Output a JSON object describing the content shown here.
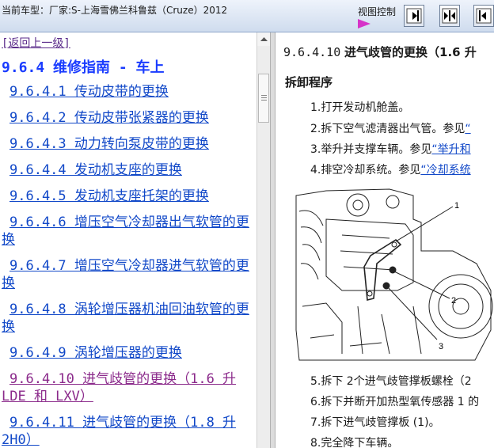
{
  "header": {
    "car_title": "当前车型：厂家:S-上海雪佛兰科鲁兹（Cruze）2012",
    "view_control_label": "视图控制"
  },
  "left": {
    "back_link": "[返回上一级]",
    "section_title": "9.6.4 维修指南 - 车上",
    "toc": [
      {
        "text": "9.6.4.1 传动皮带的更换"
      },
      {
        "text": "9.6.4.2 传动皮带张紧器的更换"
      },
      {
        "text": "9.6.4.3 动力转向泵皮带的更换"
      },
      {
        "text": "9.6.4.4 发动机支座的更换"
      },
      {
        "text": "9.6.4.5 发动机支座托架的更换"
      },
      {
        "text": "9.6.4.6 增压空气冷却器出气软管的更换"
      },
      {
        "text": "9.6.4.7 增压空气冷却器进气软管的更换"
      },
      {
        "text": "9.6.4.8 涡轮增压器机油回油软管的更换"
      },
      {
        "text": "9.6.4.9 涡轮增压器的更换"
      },
      {
        "text": "9.6.4.10 进气歧管的更换（1.6 升 LDE 和 LXV）"
      },
      {
        "text": "9.6.4.11 进气歧管的更换（1.8 升 2H0）"
      }
    ]
  },
  "right": {
    "title_num": "9.6.4.10",
    "title_text": "进气歧管的更换（1.6 升",
    "subhead": "拆卸程序",
    "steps": [
      {
        "text": "1.打开发动机舱盖。",
        "ref": ""
      },
      {
        "text": "2.拆下空气滤清器出气管。参见",
        "ref": "“"
      },
      {
        "text": "3.举升并支撑车辆。参见",
        "ref": "“举升和"
      },
      {
        "text": "4.排空冷却系统。参见",
        "ref": "“冷却系统"
      },
      {
        "text": "5.拆下 2个进气歧管撑板螺栓（2",
        "ref": ""
      },
      {
        "text": "6.拆下并断开加热型氧传感器 1 的",
        "ref": ""
      },
      {
        "text": "7.拆下进气歧管撑板  (1)。",
        "ref": ""
      },
      {
        "text": "8.完全降下车辆。",
        "ref": ""
      }
    ],
    "callouts": [
      "1",
      "2",
      "3"
    ]
  }
}
